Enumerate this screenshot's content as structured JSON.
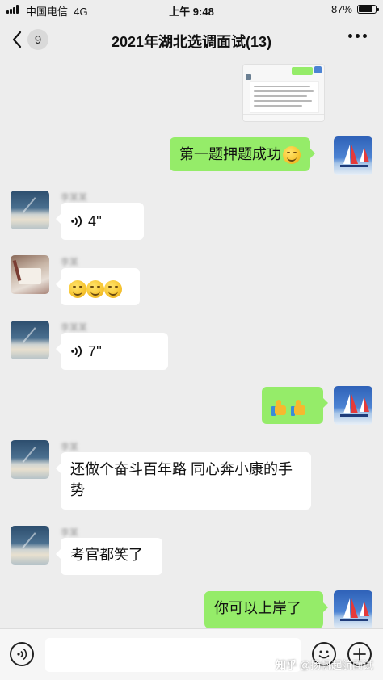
{
  "status_bar": {
    "carrier": "中国电信",
    "network": "4G",
    "time": "上午 9:48",
    "battery_percent": "87%",
    "battery_level": 0.87
  },
  "nav": {
    "back_badge": "9",
    "title": "2021年湖北选调面试(13)",
    "back_icon": "chevron-left-icon",
    "more_icon": "more-dots-icon"
  },
  "messages": [
    {
      "side": "right",
      "type": "image",
      "avatar": "none"
    },
    {
      "side": "right",
      "type": "text",
      "text": "第一题押题成功",
      "emoji": "grin-emoji"
    },
    {
      "side": "left",
      "type": "voice",
      "duration": "4''"
    },
    {
      "side": "left",
      "type": "emoji",
      "emoji": [
        "smirk-emoji",
        "smirk-emoji",
        "smirk-emoji"
      ]
    },
    {
      "side": "left",
      "type": "voice",
      "duration": "7''"
    },
    {
      "side": "right",
      "type": "emoji",
      "emoji": [
        "thumbs-up-emoji",
        "thumbs-up-emoji"
      ]
    },
    {
      "side": "left",
      "type": "text",
      "text": "还做个奋斗百年路 同心奔小康的手势"
    },
    {
      "side": "left",
      "type": "text",
      "text": "考官都笑了"
    },
    {
      "side": "right",
      "type": "text",
      "text": "你可以上岸了"
    }
  ],
  "input_bar": {
    "placeholder": "",
    "voice_icon": "voice-icon",
    "emoji_icon": "smile-icon",
    "add_icon": "plus-icon"
  },
  "watermark": {
    "site": "知乎",
    "user": "@扬帆起航面试"
  },
  "colors": {
    "background": "#ededed",
    "bubble_self": "#95ec69",
    "bubble_other": "#ffffff"
  }
}
